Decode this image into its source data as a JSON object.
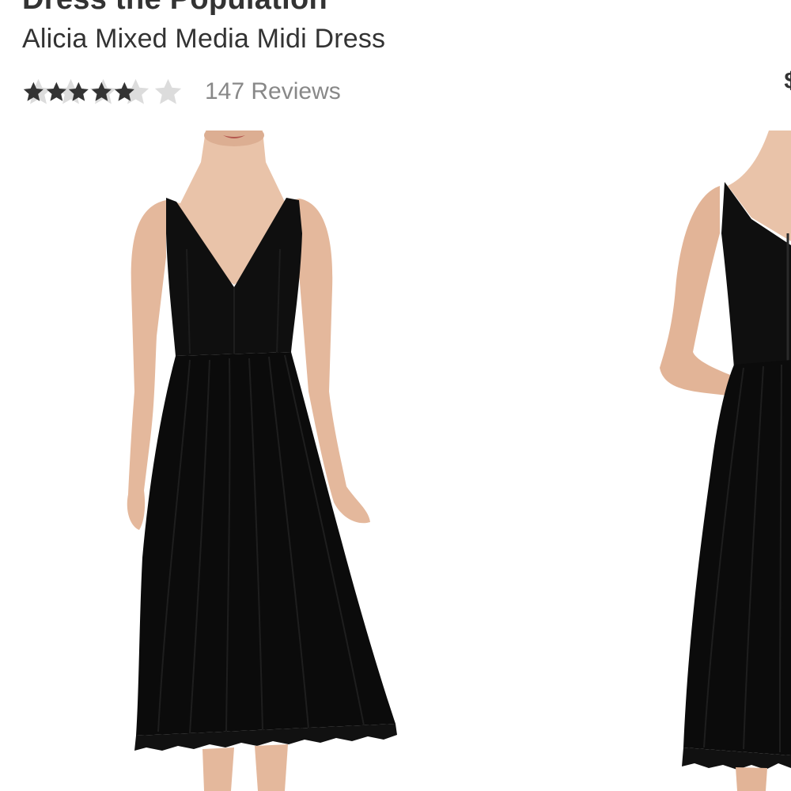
{
  "product": {
    "brand": "Dress the Population",
    "name": "Alicia Mixed Media Midi Dress",
    "rating": {
      "value": 3.5,
      "max": 5
    },
    "reviews_label": "147 Reviews",
    "price_fragment": "$"
  },
  "gallery": {
    "images": [
      {
        "alt": "front-view"
      },
      {
        "alt": "back-view"
      }
    ]
  },
  "colors": {
    "text": "#333333",
    "muted": "#888888",
    "star_filled": "#333333",
    "star_empty": "#dcdcdc",
    "dress": "#0e0e0e",
    "skin": "#e9c3a9"
  }
}
